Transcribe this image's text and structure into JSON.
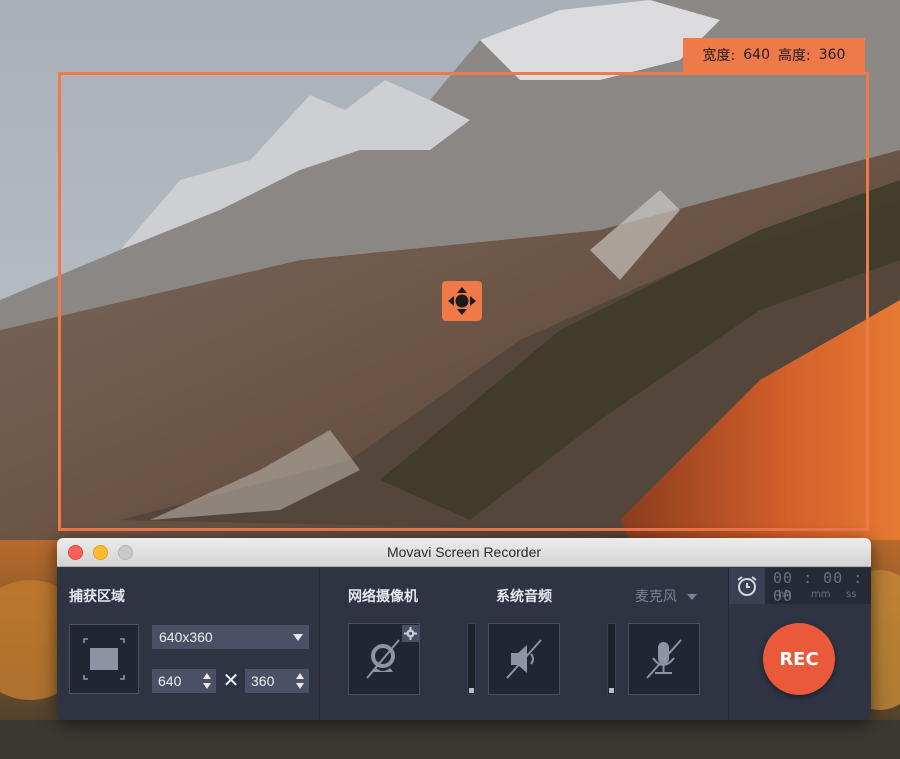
{
  "capture_overlay": {
    "width_label": "宽度:",
    "width_value": "640",
    "height_label": "高度:",
    "height_value": "360"
  },
  "window": {
    "title": "Movavi Screen Recorder"
  },
  "capture_region": {
    "label": "捕获区域",
    "preset": "640x360",
    "width": "640",
    "height": "360",
    "times_symbol": "✕"
  },
  "webcam": {
    "label": "网络摄像机"
  },
  "system_audio": {
    "label": "系统音频"
  },
  "microphone": {
    "label": "麦克风"
  },
  "timer": {
    "display": "00 : 00 : 00",
    "unit_hh": "hh",
    "unit_mm": "mm",
    "unit_ss": "ss"
  },
  "rec": {
    "label": "REC"
  },
  "colors": {
    "accent": "#f0794a",
    "rec": "#ea5a3a",
    "panel": "#2f3443"
  },
  "icons": {
    "move": "move-arrows-icon",
    "region": "screen-region-icon",
    "webcam": "webcam-off-icon",
    "system_audio": "speaker-muted-icon",
    "microphone": "microphone-muted-icon",
    "gear": "gear-icon",
    "alarm": "alarm-clock-icon"
  }
}
